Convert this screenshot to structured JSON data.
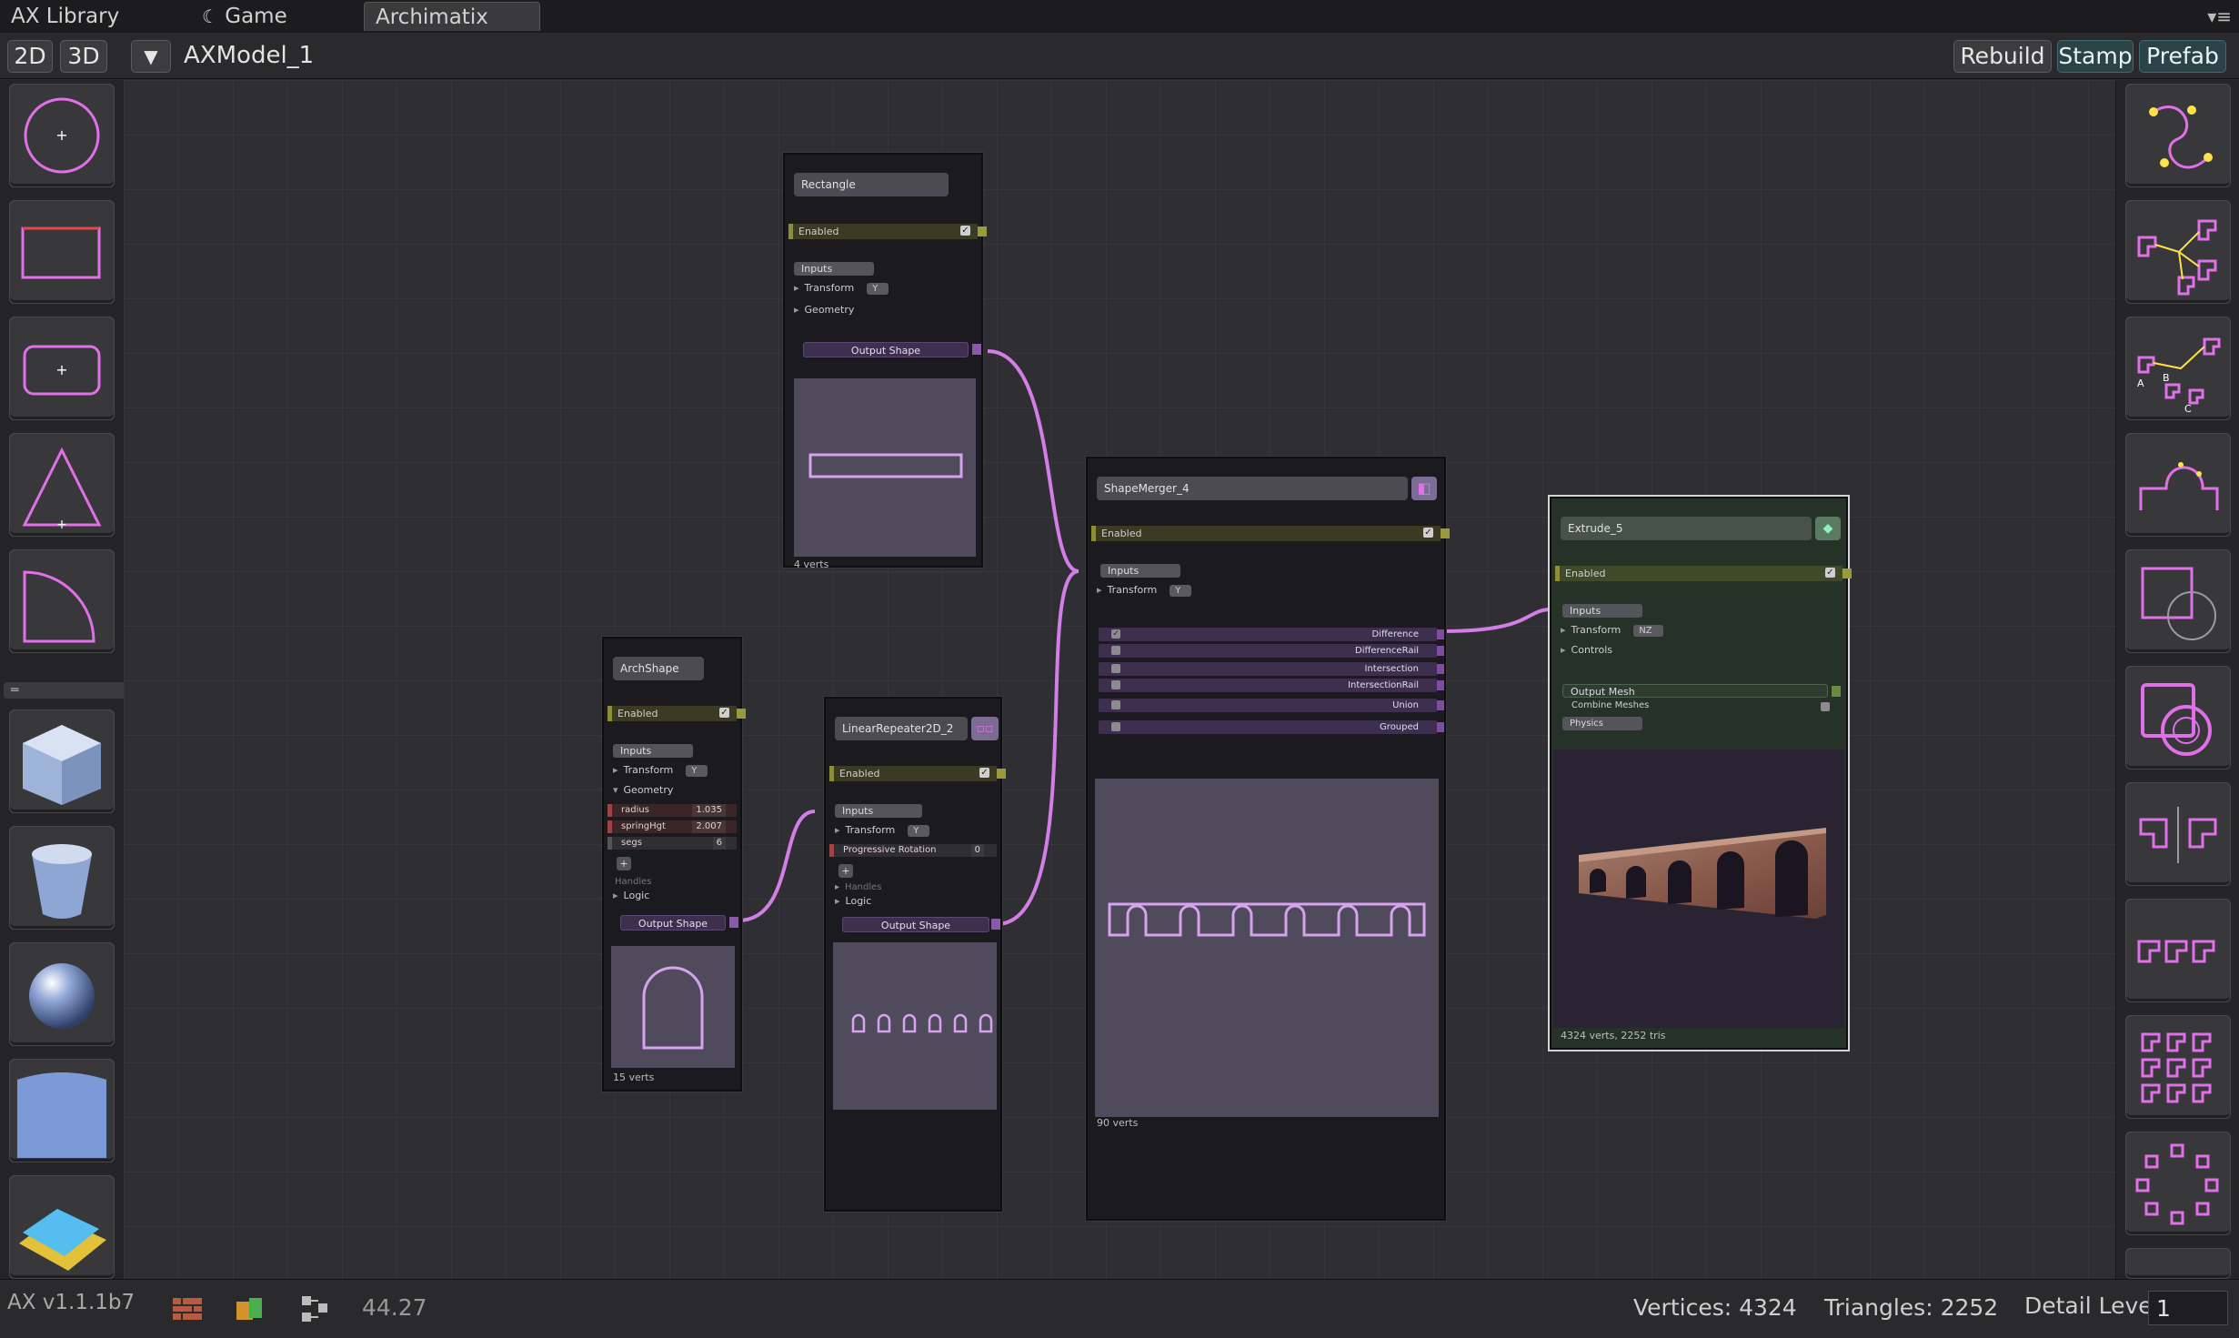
{
  "tabs": [
    {
      "label": "AX Library"
    },
    {
      "label": "Game"
    },
    {
      "label": "Archimatix"
    }
  ],
  "toolbar": {
    "btn_2d": "2D",
    "btn_3d": "3D",
    "dropdown_icon": "▼",
    "model_name": "AXModel_1",
    "rebuild": "Rebuild",
    "stamp": "Stamp",
    "prefab": "Prefab",
    "menu_icon": "▾≡"
  },
  "colors": {
    "accent": "#e070e8",
    "wire": "#d27ee6",
    "teal_button": "#2b4247"
  },
  "left_tools": [
    "circle-icon",
    "rectangle-icon",
    "rounded-rect-icon",
    "triangle-icon",
    "quarter-arc-icon",
    "cube-icon",
    "cylinder-icon",
    "sphere-icon",
    "plane-icon",
    "box-icon"
  ],
  "right_tools": [
    "spline-icon",
    "branch-shapes-icon",
    "merge-abc-icon",
    "bevel-path-icon",
    "square-circle-icon",
    "offset-shape-icon",
    "mirror-icon",
    "repeater-icon",
    "grid-repeater-icon",
    "radial-repeater-icon"
  ],
  "nodes": {
    "rectangle": {
      "title": "Rectangle",
      "enabled": "Enabled",
      "inputs": "Inputs",
      "transform": "Transform",
      "transform_axis": "Y",
      "geometry": "Geometry",
      "output": "Output Shape",
      "verts": "4 verts"
    },
    "arch": {
      "title": "ArchShape",
      "enabled": "Enabled",
      "inputs": "Inputs",
      "transform": "Transform",
      "transform_axis": "Y",
      "geometry": "Geometry",
      "params": [
        {
          "name": "radius",
          "value": "1.035"
        },
        {
          "name": "springHgt",
          "value": "2.007"
        },
        {
          "name": "segs",
          "value": "6"
        }
      ],
      "handles": "Handles",
      "logic": "Logic",
      "output": "Output Shape",
      "verts": "15 verts"
    },
    "repeater": {
      "title": "LinearRepeater2D_2",
      "enabled": "Enabled",
      "inputs": "Inputs",
      "transform": "Transform",
      "transform_axis": "Y",
      "progressive": "Progressive Rotation",
      "progressive_value": "0",
      "handles": "Handles",
      "logic": "Logic",
      "output": "Output Shape"
    },
    "merger": {
      "title": "ShapeMerger_4",
      "enabled": "Enabled",
      "inputs": "Inputs",
      "transform": "Transform",
      "transform_axis": "Y",
      "outputs": [
        "Difference",
        "DifferenceRail",
        "Intersection",
        "IntersectionRail",
        "Union",
        "Grouped"
      ],
      "verts": "90 verts"
    },
    "extrude": {
      "title": "Extrude_5",
      "enabled": "Enabled",
      "inputs": "Inputs",
      "transform": "Transform",
      "transform_axis": "NZ",
      "controls": "Controls",
      "output_mesh": "Output Mesh",
      "combine_meshes": "Combine Meshes",
      "physics": "Physics",
      "stats": "4324 verts, 2252 tris"
    }
  },
  "status": {
    "version": "AX v1.1.1b7",
    "fps": "44.27",
    "vertices": "Vertices: 4324",
    "triangles": "Triangles: 2252",
    "detail_label": "Detail Level",
    "detail_value": "1"
  }
}
